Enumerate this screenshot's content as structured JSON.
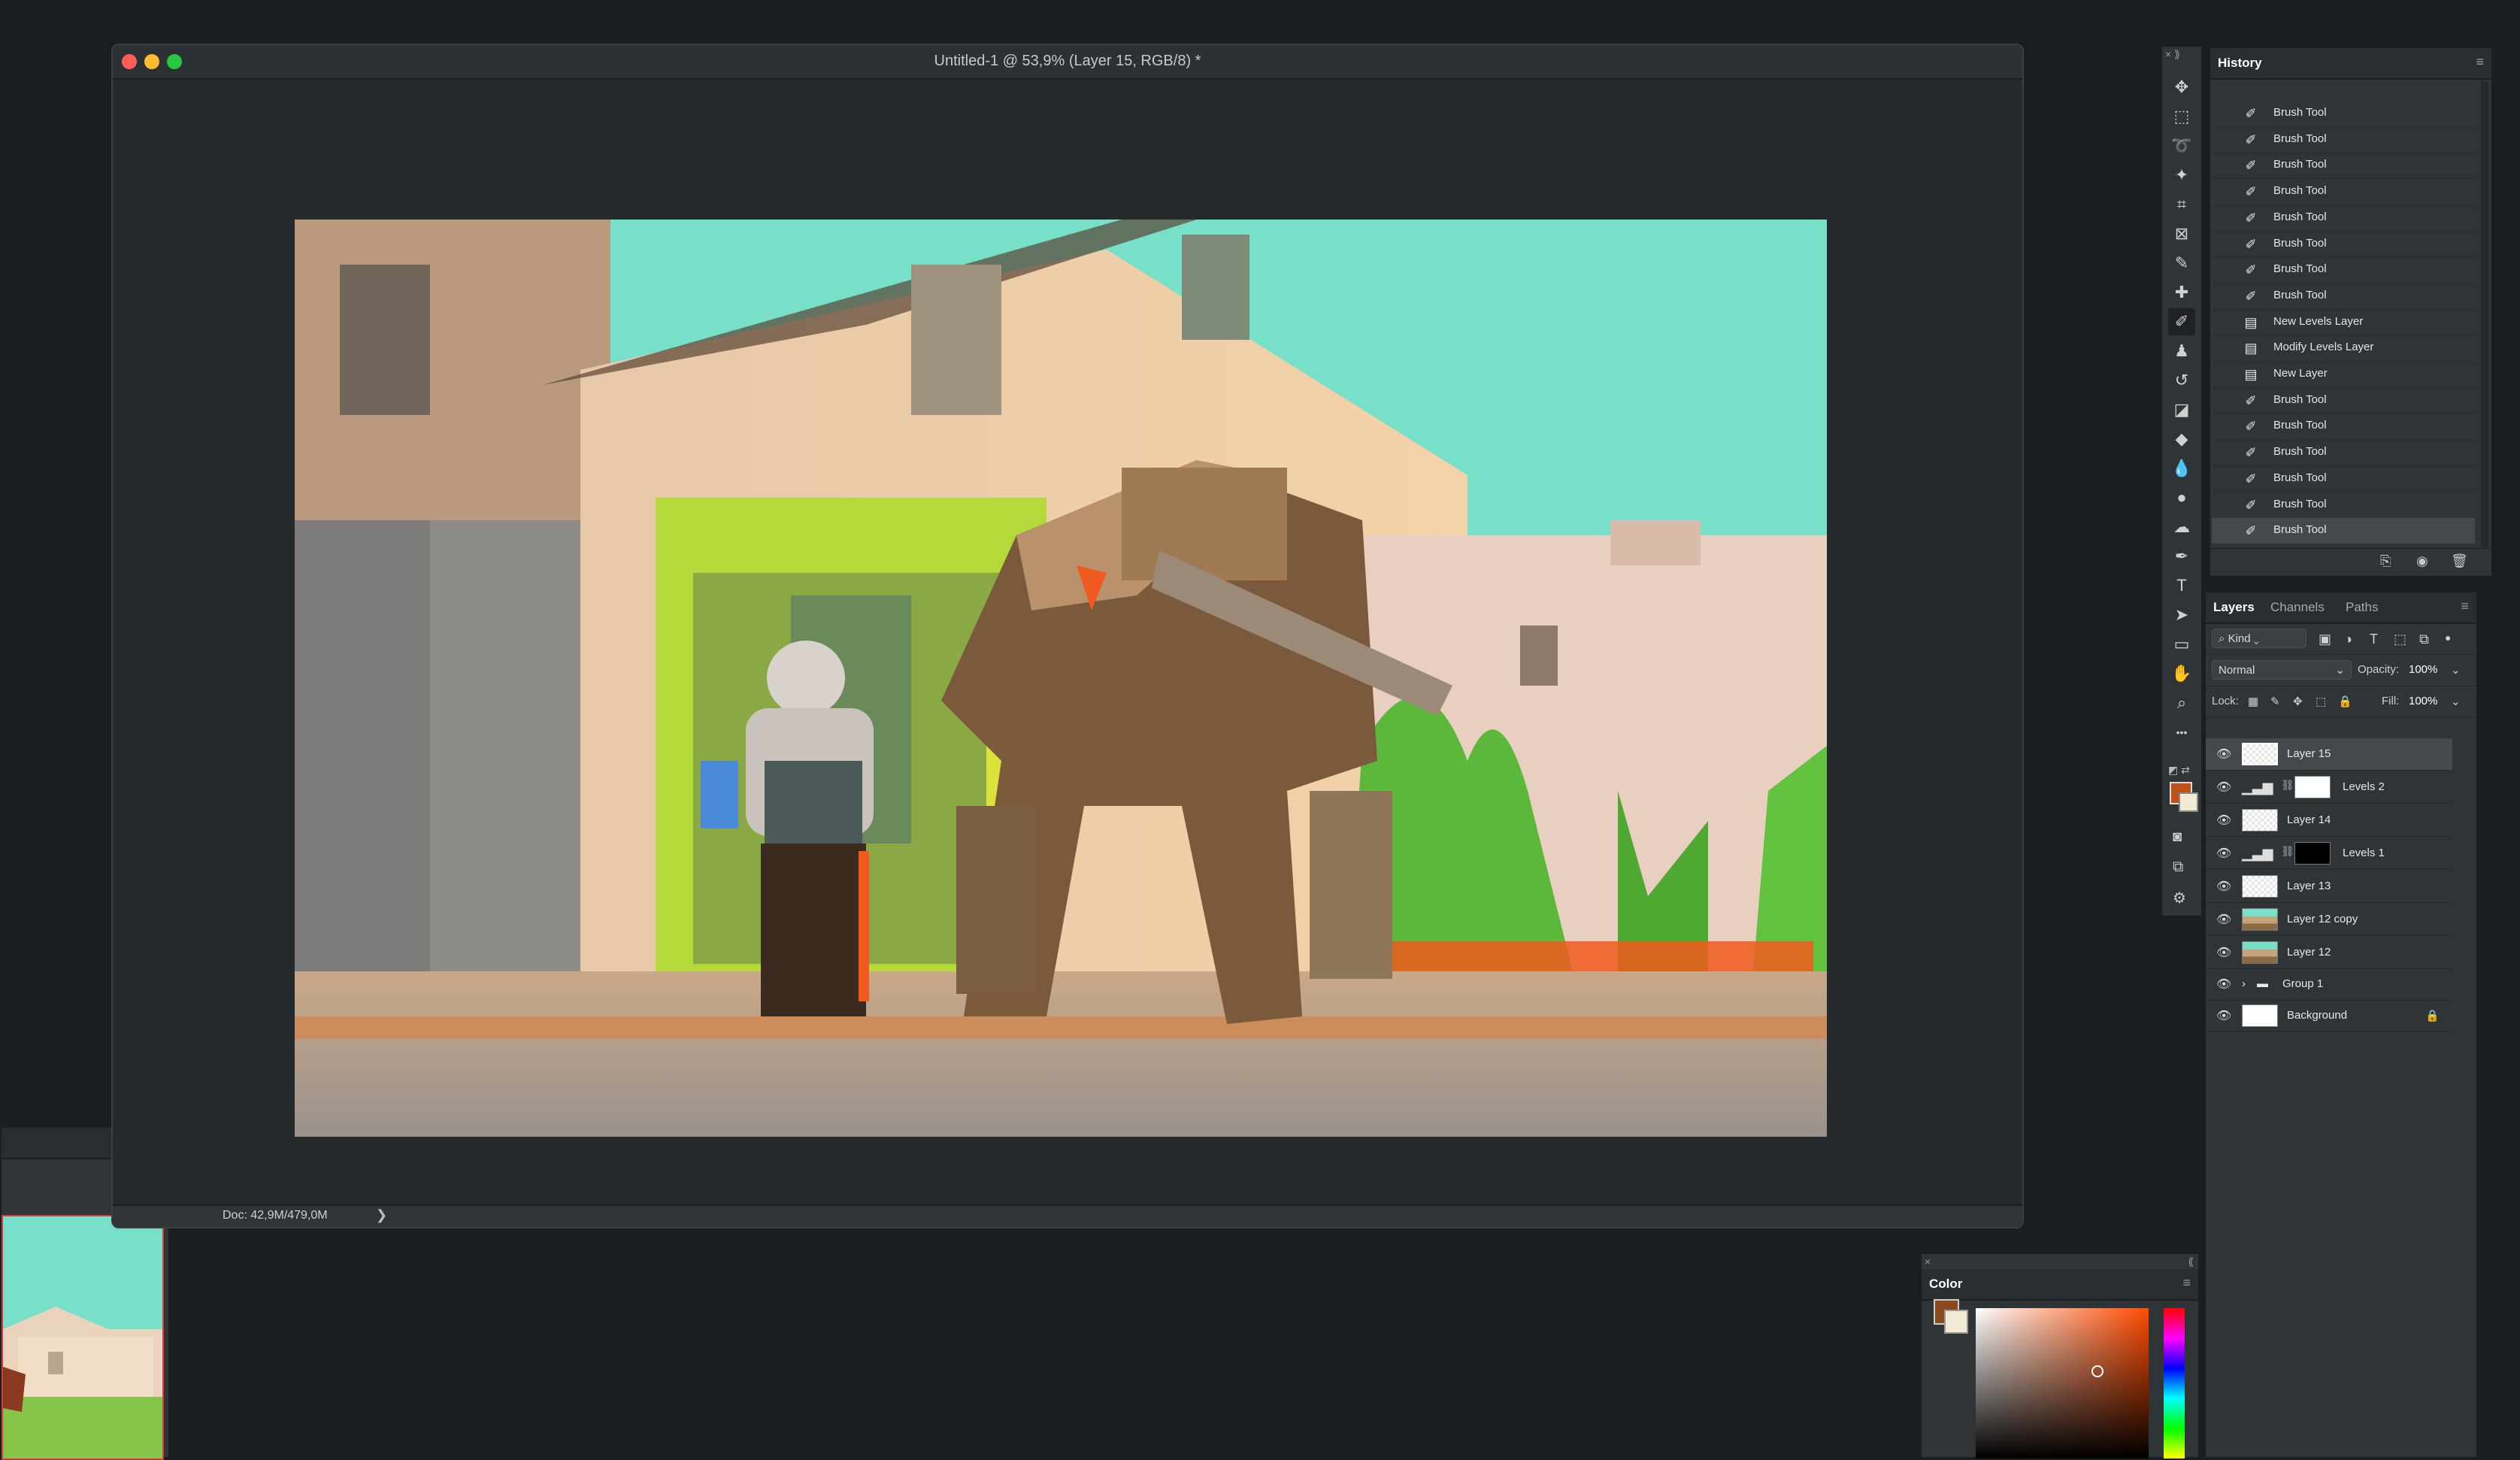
{
  "document": {
    "title": "Untitled-1 @ 53,9% (Layer 15, RGB/8) *",
    "status": "Doc: 42,9M/479,0M",
    "status_arrow": "❯"
  },
  "toolbar": {
    "tools": [
      {
        "name": "move-tool-icon",
        "glyph": "✥"
      },
      {
        "name": "marquee-tool-icon",
        "glyph": "⬚"
      },
      {
        "name": "lasso-tool-icon",
        "glyph": "➰"
      },
      {
        "name": "magic-wand-icon",
        "glyph": "✦"
      },
      {
        "name": "crop-tool-icon",
        "glyph": "⌗"
      },
      {
        "name": "frame-tool-icon",
        "glyph": "⊠"
      },
      {
        "name": "eyedropper-icon",
        "glyph": "✎"
      },
      {
        "name": "healing-brush-icon",
        "glyph": "✚"
      },
      {
        "name": "brush-tool-icon",
        "glyph": "✐"
      },
      {
        "name": "stamp-tool-icon",
        "glyph": "♟"
      },
      {
        "name": "history-brush-icon",
        "glyph": "↺"
      },
      {
        "name": "eraser-icon",
        "glyph": "◪"
      },
      {
        "name": "paint-bucket-icon",
        "glyph": "◆"
      },
      {
        "name": "blur-tool-icon",
        "glyph": "💧"
      },
      {
        "name": "dodge-tool-icon",
        "glyph": "●"
      },
      {
        "name": "smudge-tool-icon",
        "glyph": "☁"
      },
      {
        "name": "pen-tool-icon",
        "glyph": "✒"
      },
      {
        "name": "type-tool-icon",
        "glyph": "T"
      },
      {
        "name": "path-select-icon",
        "glyph": "➤"
      },
      {
        "name": "rectangle-tool-icon",
        "glyph": "▭"
      },
      {
        "name": "hand-tool-icon",
        "glyph": "✋"
      },
      {
        "name": "zoom-tool-icon",
        "glyph": "⌕"
      },
      {
        "name": "more-tools-icon",
        "glyph": "•••"
      }
    ],
    "active_index": 8
  },
  "history": {
    "tab": "History",
    "items": [
      {
        "label": "Brush Tool",
        "icon": "brush"
      },
      {
        "label": "Brush Tool",
        "icon": "brush"
      },
      {
        "label": "Brush Tool",
        "icon": "brush"
      },
      {
        "label": "Brush Tool",
        "icon": "brush"
      },
      {
        "label": "Brush Tool",
        "icon": "brush"
      },
      {
        "label": "Brush Tool",
        "icon": "brush"
      },
      {
        "label": "Brush Tool",
        "icon": "brush"
      },
      {
        "label": "Brush Tool",
        "icon": "brush"
      },
      {
        "label": "New Levels Layer",
        "icon": "doc"
      },
      {
        "label": "Modify Levels Layer",
        "icon": "doc"
      },
      {
        "label": "New Layer",
        "icon": "doc"
      },
      {
        "label": "Brush Tool",
        "icon": "brush"
      },
      {
        "label": "Brush Tool",
        "icon": "brush"
      },
      {
        "label": "Brush Tool",
        "icon": "brush"
      },
      {
        "label": "Brush Tool",
        "icon": "brush"
      },
      {
        "label": "Brush Tool",
        "icon": "brush"
      },
      {
        "label": "Brush Tool",
        "icon": "brush"
      }
    ]
  },
  "layers_panel": {
    "tabs": [
      "Layers",
      "Channels",
      "Paths"
    ],
    "kind_filter": "Kind",
    "blend_mode": "Normal",
    "opacity_label": "Opacity:",
    "opacity_value": "100%",
    "lock_label": "Lock:",
    "fill_label": "Fill:",
    "fill_value": "100%",
    "layers": [
      {
        "name": "Layer 15",
        "type": "pixel",
        "selected": true
      },
      {
        "name": "Levels 2",
        "type": "adjustment",
        "mask": "white"
      },
      {
        "name": "Layer 14",
        "type": "pixel"
      },
      {
        "name": "Levels 1",
        "type": "adjustment",
        "mask": "black"
      },
      {
        "name": "Layer 13",
        "type": "pixel"
      },
      {
        "name": "Layer 12 copy",
        "type": "image"
      },
      {
        "name": "Layer 12",
        "type": "image"
      },
      {
        "name": "Group 1",
        "type": "group"
      },
      {
        "name": "Background",
        "type": "background",
        "locked": true
      }
    ]
  },
  "color_panel": {
    "tab": "Color",
    "foreground": "#8b4a1e",
    "background": "#f2ead2"
  },
  "colors": {
    "sky": "#78e0c8",
    "accent_orange": "#f05a1e"
  }
}
